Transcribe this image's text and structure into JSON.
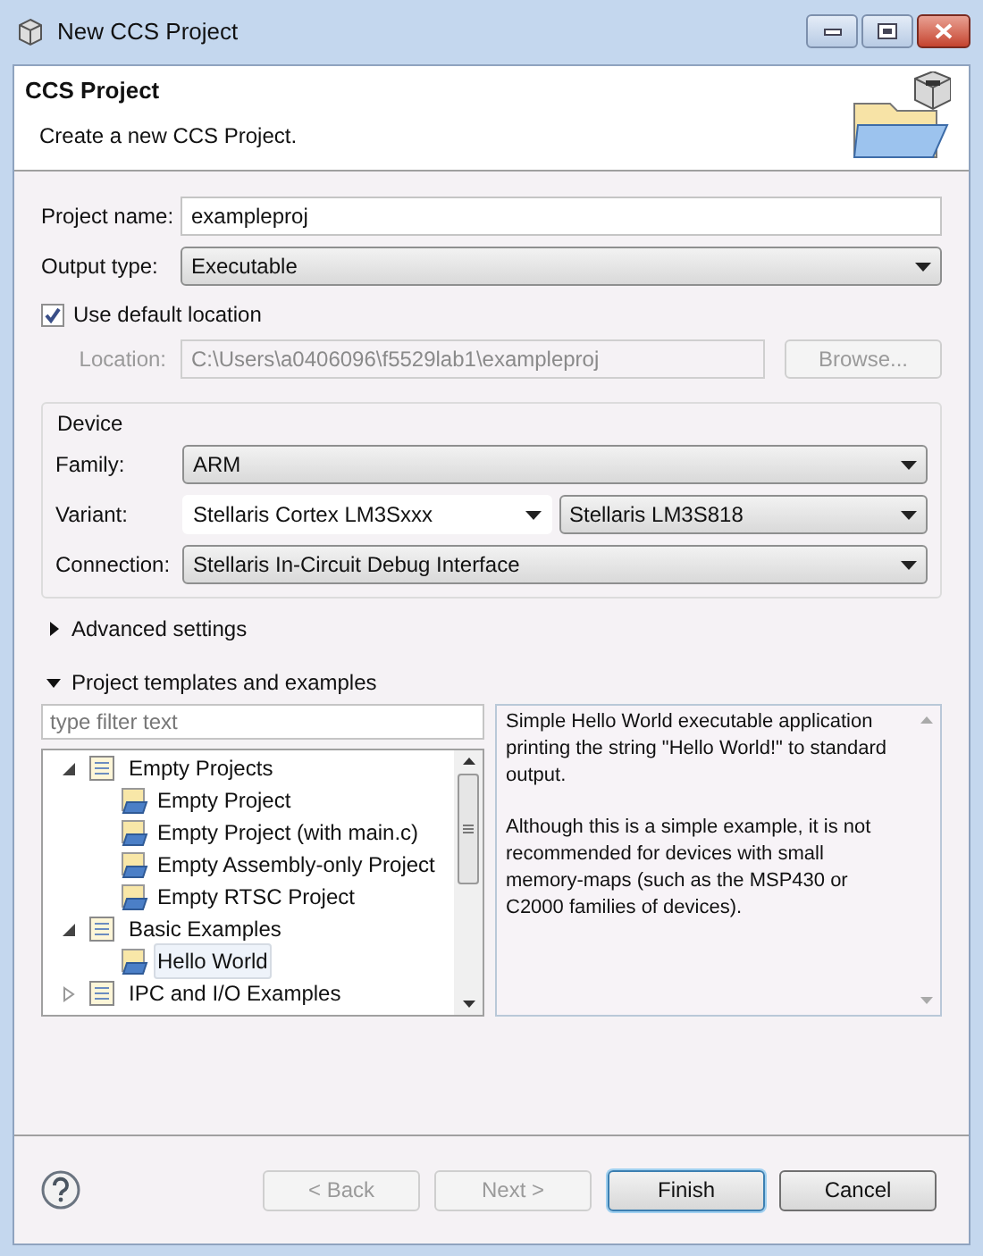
{
  "window": {
    "title": "New CCS Project"
  },
  "header": {
    "title": "CCS Project",
    "subtitle": "Create a new CCS Project."
  },
  "form": {
    "project_name": {
      "label": "Project name:",
      "value": "exampleproj"
    },
    "output_type": {
      "label": "Output type:",
      "value": "Executable"
    },
    "use_default_location": {
      "label": "Use default location",
      "checked": true
    },
    "location": {
      "label": "Location:",
      "value": "C:\\Users\\a0406096\\f5529lab1\\exampleproj",
      "disabled": true
    },
    "browse_button": {
      "label": "Browse...",
      "disabled": true
    }
  },
  "device": {
    "title": "Device",
    "family": {
      "label": "Family:",
      "value": "ARM"
    },
    "variant": {
      "label": "Variant:",
      "value": "Stellaris Cortex LM3Sxxx",
      "value_2": "Stellaris LM3S818"
    },
    "connection": {
      "label": "Connection:",
      "value": "Stellaris In-Circuit Debug Interface"
    }
  },
  "sections": [
    {
      "label": "Advanced settings",
      "expanded": false
    },
    {
      "label": "Project templates and examples",
      "expanded": true
    }
  ],
  "templates": {
    "filter": {
      "placeholder": "type filter text"
    },
    "tree": [
      {
        "label": "Empty Projects",
        "expanded": true,
        "children": [
          {
            "label": "Empty Project",
            "selected": false
          },
          {
            "label": "Empty Project (with main.c)",
            "selected": false
          },
          {
            "label": "Empty Assembly-only Project",
            "selected": false
          },
          {
            "label": "Empty RTSC Project",
            "selected": false
          }
        ]
      },
      {
        "label": "Basic Examples",
        "expanded": true,
        "children": [
          {
            "label": "Hello World",
            "selected": true
          }
        ]
      },
      {
        "label": "IPC and I/O Examples",
        "expanded": false
      }
    ],
    "description": [
      "Simple Hello World executable application printing the string \"Hello World!\" to standard output.",
      "Although this is a simple example, it is not recommended for devices with small memory-maps (such as the MSP430 or C2000 families of devices)."
    ]
  },
  "buttons": [
    {
      "label": "< Back",
      "disabled": true,
      "default": false
    },
    {
      "label": "Next >",
      "disabled": true,
      "default": false
    },
    {
      "label": "Finish",
      "disabled": false,
      "default": true
    },
    {
      "label": "Cancel",
      "disabled": false,
      "default": false
    }
  ]
}
